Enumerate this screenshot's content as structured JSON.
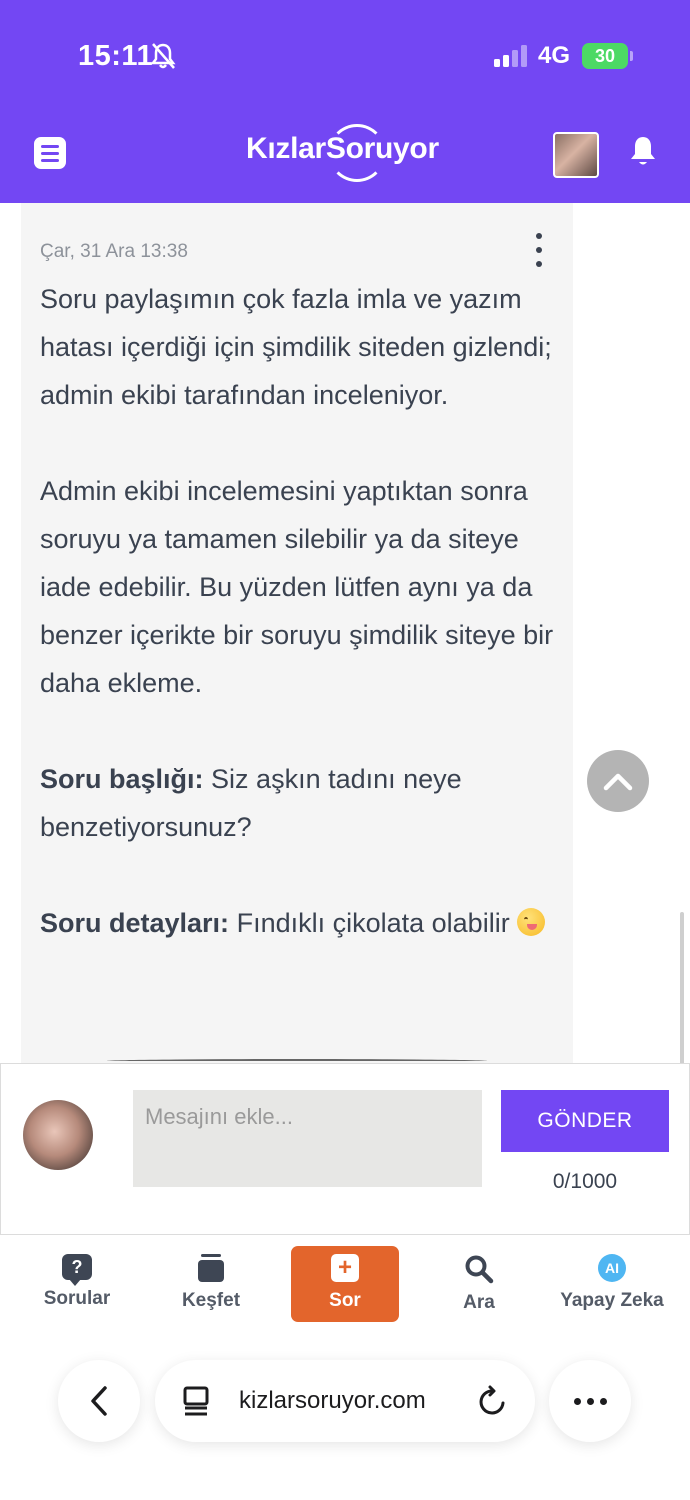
{
  "status_bar": {
    "time": "15:11",
    "network": "4G",
    "battery": "30"
  },
  "header": {
    "logo_text": "KızlarSoruyor",
    "menu_icon": "menu-icon",
    "bell_icon": "bell-icon",
    "brand_color": "#7347f3"
  },
  "message": {
    "date": "Çar, 31 Ara 13:38",
    "paragraph_1": "Soru paylaşımın çok fazla imla ve yazım hatası içerdiği için şimdilik siteden gizlendi; admin ekibi tarafından inceleniyor.",
    "paragraph_2": "Admin ekibi incelemesini yaptıktan sonra soruyu ya tamamen silebilir ya da siteye iade edebilir. Bu yüzden lütfen aynı ya da benzer içerikte bir soruyu şimdilik siteye bir daha ekleme.",
    "title_label": "Soru başlığı:",
    "title_value": "Siz aşkın tadını neye benzetiyorsunuz?",
    "details_label": "Soru detayları:",
    "details_value": "Fındıklı çikolata olabilir"
  },
  "composer": {
    "placeholder": "Mesajını ekle...",
    "send_label": "GÖNDER",
    "counter": "0/1000"
  },
  "bottom_nav": {
    "items": [
      {
        "label": "Sorular",
        "icon": "question-bubble-icon"
      },
      {
        "label": "Keşfet",
        "icon": "cards-icon"
      },
      {
        "label": "Sor",
        "icon": "plus-icon"
      },
      {
        "label": "Ara",
        "icon": "search-icon"
      },
      {
        "label": "Yapay Zeka",
        "icon": "ai-icon"
      }
    ],
    "active_color": "#e3652c"
  },
  "browser": {
    "url": "kizlarsoruyor.com"
  }
}
